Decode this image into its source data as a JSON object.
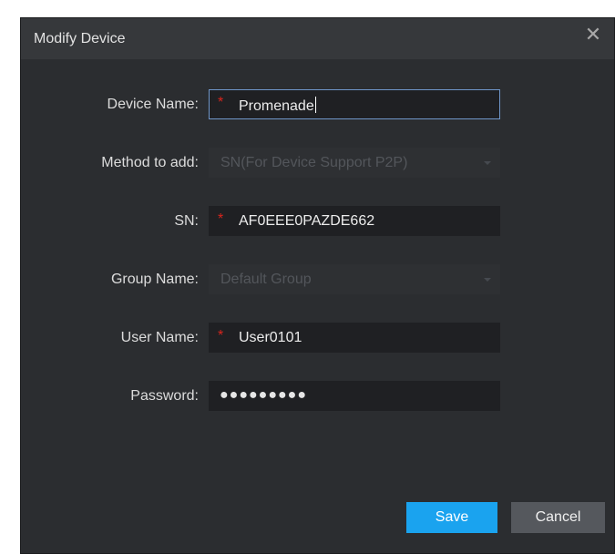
{
  "dialog": {
    "title": "Modify Device",
    "close_glyph": "✕"
  },
  "form": {
    "device_name": {
      "label": "Device Name:",
      "required": "*",
      "value": "Promenade"
    },
    "method_to_add": {
      "label": "Method to add:",
      "value": "SN(For Device Support P2P)"
    },
    "sn": {
      "label": "SN:",
      "required": "*",
      "value": "AF0EEE0PAZDE662"
    },
    "group_name": {
      "label": "Group Name:",
      "value": "Default Group"
    },
    "user_name": {
      "label": "User Name:",
      "required": "*",
      "value": "User0101"
    },
    "password": {
      "label": "Password:",
      "masked_value": "●●●●●●●●●"
    }
  },
  "buttons": {
    "save": "Save",
    "cancel": "Cancel"
  },
  "colors": {
    "accent": "#1aa3ef",
    "required": "#d9251d",
    "dialog_bg": "#2b2d30"
  }
}
